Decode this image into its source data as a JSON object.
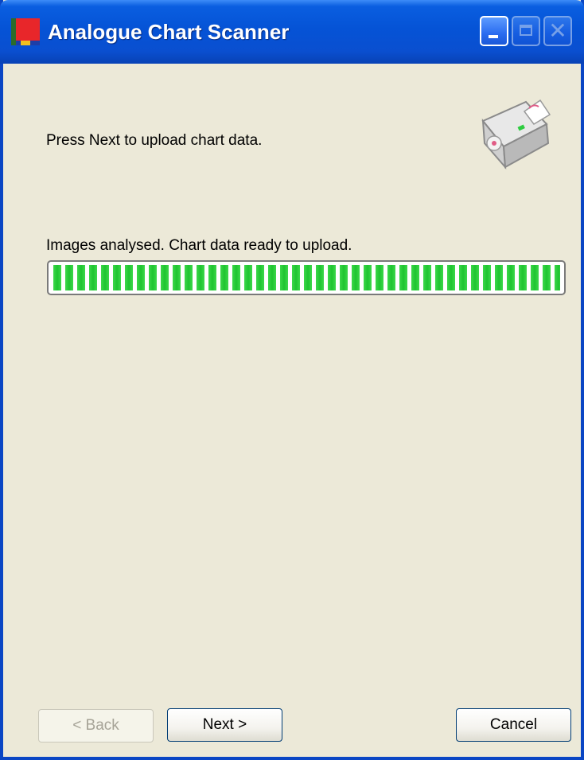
{
  "window": {
    "title": "Analogue Chart Scanner",
    "controls": {
      "minimize": "minimize",
      "maximize": "maximize",
      "close": "close"
    }
  },
  "content": {
    "instruction": "Press Next to upload chart data.",
    "status": "Images analysed.  Chart data ready to upload.",
    "progress_percent": 100,
    "progress_color": "#1ec430",
    "icon": "scanner-icon"
  },
  "buttons": {
    "back": {
      "label": "< Back",
      "enabled": false
    },
    "next": {
      "label": "Next >",
      "enabled": true
    },
    "cancel": {
      "label": "Cancel",
      "enabled": true
    }
  },
  "colors": {
    "titlebar": "#0553d6",
    "dialog_bg": "#ece9d8"
  }
}
